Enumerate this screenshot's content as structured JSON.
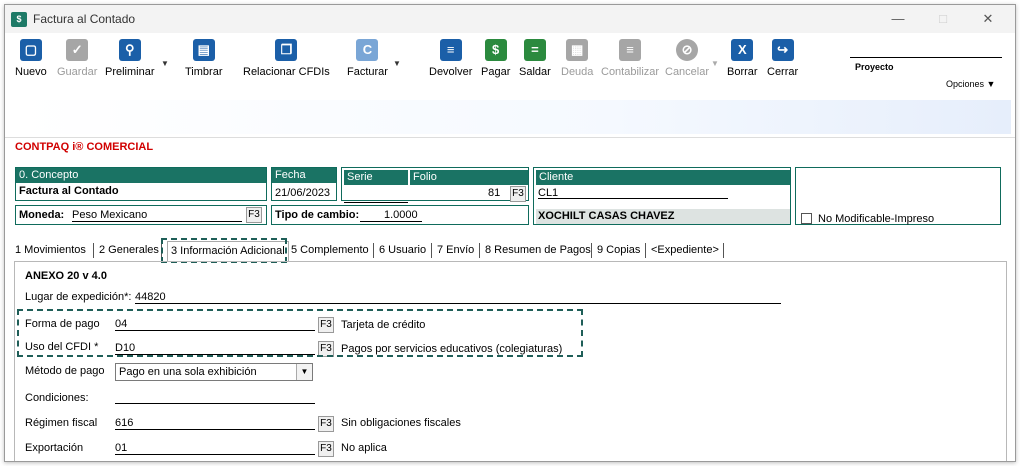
{
  "window": {
    "title": "Factura al Contado"
  },
  "toolbar": {
    "nuevo": "Nuevo",
    "guardar": "Guardar",
    "preliminar": "Preliminar",
    "timbrar": "Timbrar",
    "relacionar": "Relacionar CFDIs",
    "facturar": "Facturar",
    "devolver": "Devolver",
    "pagar": "Pagar",
    "saldar": "Saldar",
    "deuda": "Deuda",
    "contabilizar": "Contabilizar",
    "cancelar": "Cancelar",
    "borrar": "Borrar",
    "cerrar": "Cerrar",
    "proyecto": "Proyecto",
    "opciones": "Opciones"
  },
  "brand": "CONTPAQ i® COMERCIAL",
  "header": {
    "concepto_label": "0. Concepto",
    "concepto_value": "Factura al Contado",
    "fecha_label": "Fecha",
    "fecha_value": "21/06/2023",
    "serie_label": "Serie",
    "folio_label": "Folio",
    "folio_value": "81",
    "cliente_label": "Cliente",
    "cliente_code": "CL1",
    "cliente_name": "XOCHILT CASAS CHAVEZ",
    "moneda_label": "Moneda:",
    "moneda_value": "Peso Mexicano",
    "tipo_cambio_label": "Tipo de cambio:",
    "tipo_cambio_value": "1.0000",
    "no_modificable": "No Modificable-Impreso",
    "f3": "F3"
  },
  "tabs": [
    "1 Movimientos",
    "2 Generales",
    "3 Información Adicional",
    "5 Complemento",
    "6 Usuario",
    "7 Envío",
    "8 Resumen de Pagos",
    "9 Copias",
    "<Expediente>"
  ],
  "panel": {
    "section_title": "ANEXO 20 v 4.0",
    "lugar_label": "Lugar de expedición*:",
    "lugar_value": "44820",
    "forma_label": "Forma de pago",
    "forma_value": "04",
    "forma_desc": "Tarjeta de crédito",
    "uso_label": "Uso del CFDI *",
    "uso_value": "D10",
    "uso_desc": "Pagos por servicios educativos (colegiaturas)",
    "metodo_label": "Método de pago",
    "metodo_value": "Pago en una sola exhibición",
    "condiciones_label": "Condiciones:",
    "regimen_label": "Régimen fiscal",
    "regimen_value": "616",
    "regimen_desc": "Sin obligaciones fiscales",
    "exportacion_label": "Exportación",
    "exportacion_value": "01",
    "exportacion_desc": "No aplica"
  },
  "colors": {
    "accent": "#1a7364",
    "brand_red": "#d10000",
    "icon_blue": "#1b5fa8"
  }
}
